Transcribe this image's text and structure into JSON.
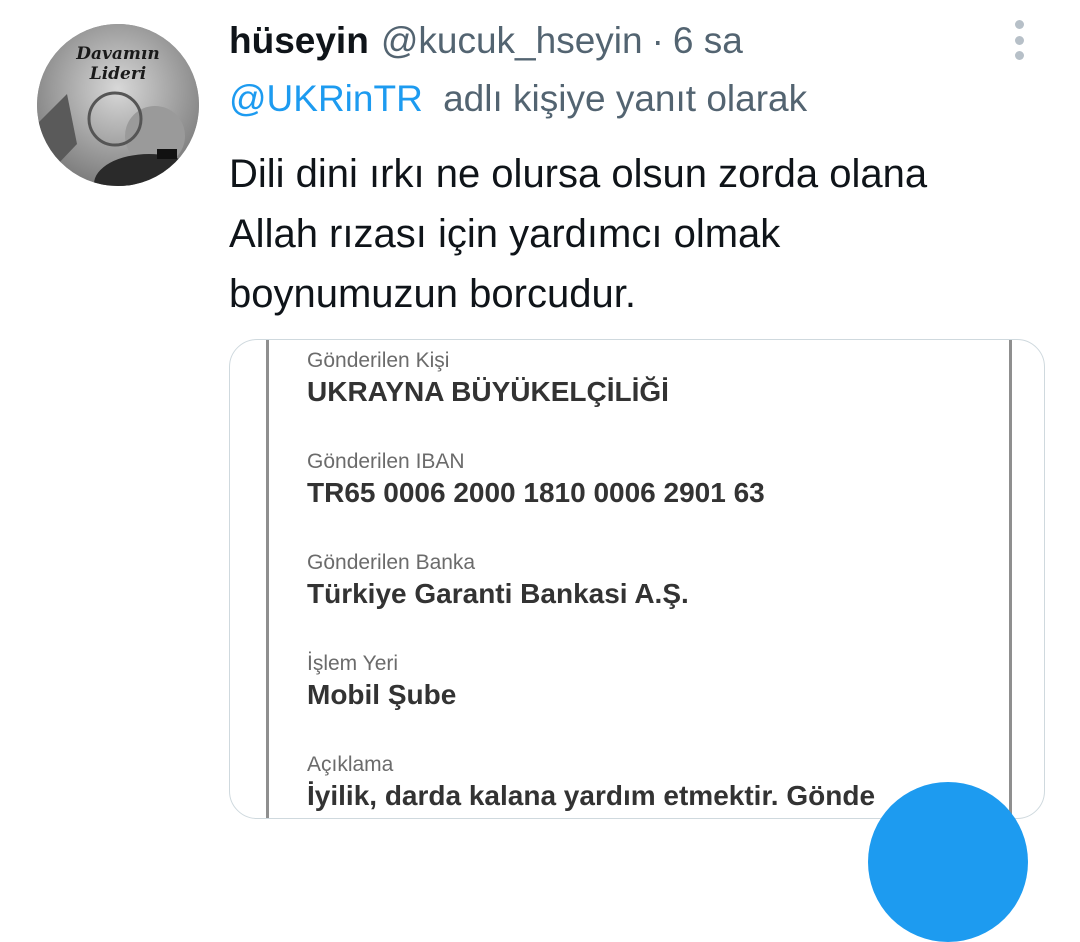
{
  "author": {
    "name": "hüseyin",
    "handle": "@kucuk_hseyin",
    "separator": "·",
    "time": "6 sa",
    "avatar_text": [
      "Davamın",
      "Lideri"
    ]
  },
  "reply": {
    "mention": "@UKRinTR",
    "suffix": "adlı kişiye yanıt olarak"
  },
  "tweet": {
    "lines": [
      "Dili dini ırkı ne olursa olsun zorda olana",
      "Allah rızası için yardımcı olmak",
      "boynumuzun borcudur."
    ]
  },
  "media": {
    "fields": [
      {
        "label": "Gönderilen Kişi",
        "value": "UKRAYNA BÜYÜKELÇİLİĞİ"
      },
      {
        "label": "Gönderilen IBAN",
        "value": "TR65 0006 2000 1810 0006 2901 63"
      },
      {
        "label": "Gönderilen Banka",
        "value": "Türkiye Garanti Bankasi A.Ş."
      },
      {
        "label": "İşlem Yeri",
        "value": "Mobil Şube"
      },
      {
        "label": "Açıklama",
        "value": "İyilik, darda kalana yardım etmektir. Gönde"
      }
    ]
  },
  "icons": {
    "more": "more-vertical-icon",
    "compose": "compose-fab"
  },
  "colors": {
    "accent": "#1d9bf0",
    "secondary_text": "#536471"
  }
}
